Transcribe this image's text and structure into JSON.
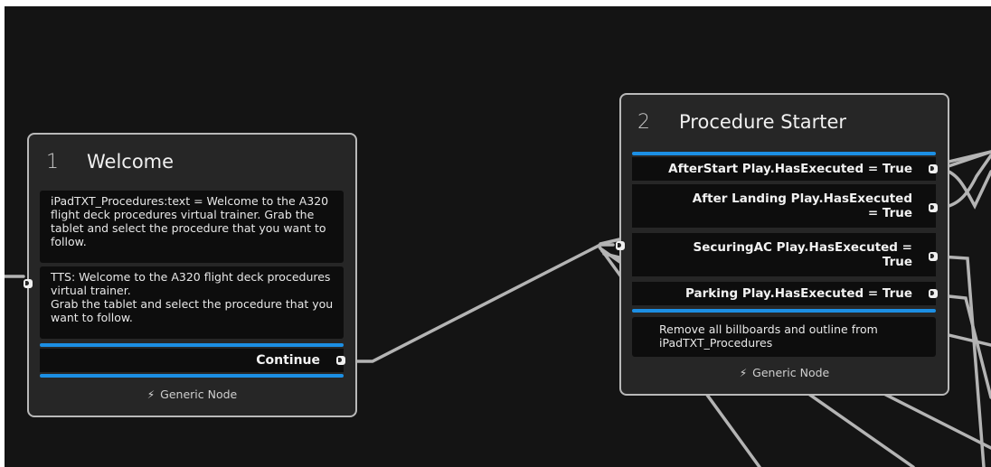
{
  "nodes": {
    "welcome": {
      "number": "1",
      "title": "Welcome",
      "actions": [
        "iPadTXT_Procedures:text = Welcome to the A320 flight deck procedures virtual trainer. Grab the tablet and select the procedure that you want to follow.",
        "TTS: Welcome to the A320 flight deck procedures virtual trainer.\nGrab the tablet and select the procedure that you want to follow."
      ],
      "outputs": [
        "Continue"
      ],
      "footer": "Generic Node",
      "footer_icon": "lightning-bolt-icon"
    },
    "procedure_starter": {
      "number": "2",
      "title": "Procedure Starter",
      "outputs": [
        "AfterStart Play.HasExecuted = True",
        "After Landing Play.HasExecuted = True",
        "SecuringAC Play.HasExecuted = True",
        "Parking Play.HasExecuted = True"
      ],
      "actions": [
        "Remove all billboards and outline from iPadTXT_Procedures"
      ],
      "footer": "Generic Node",
      "footer_icon": "lightning-bolt-icon"
    }
  },
  "colors": {
    "canvas": "#141414",
    "node_body": "#262626",
    "node_border": "#b9b9b9",
    "accent": "#1c8fe4",
    "wire": "#b4b4b4"
  }
}
